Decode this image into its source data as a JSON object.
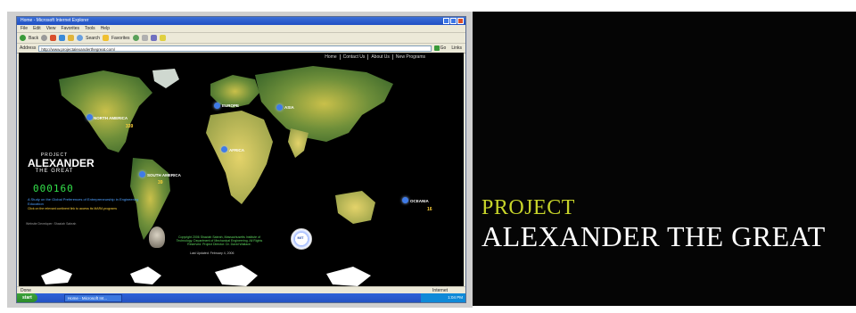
{
  "window": {
    "title": "Home - Microsoft Internet Explorer",
    "menu": [
      "File",
      "Edit",
      "View",
      "Favorites",
      "Tools",
      "Help"
    ],
    "toolbar": {
      "back": "Back",
      "search": "Search",
      "favorites": "Favorites"
    },
    "address_label": "Address",
    "address_value": "http://www.projectalexanderthegreat.com/",
    "go_label": "Go",
    "links_label": "Links",
    "status": "Done",
    "status_zone": "Internet"
  },
  "taskbar": {
    "start": "start",
    "task": "Home - Microsoft Int...",
    "time": "1:04 PM"
  },
  "site": {
    "nav": [
      "Home",
      "Contact Us",
      "About Us",
      "New Programs"
    ],
    "regions": [
      {
        "label": "NORTH AMERICA",
        "count": "339"
      },
      {
        "label": "EUROPE",
        "count": ""
      },
      {
        "label": "ASIA",
        "count": ""
      },
      {
        "label": "AFRICA",
        "count": ""
      },
      {
        "label": "SOUTH AMERICA",
        "count": "39"
      },
      {
        "label": "OCEANIA",
        "count": "16"
      }
    ],
    "logo": {
      "line1": "PROJECT",
      "line2": "ALEXANDER",
      "line3": "THE GREAT"
    },
    "counter": "000160",
    "subtitle": "A Study on the Global Preferences of Entrepreneurship in Engineering Education",
    "note": "Click on the relevant continent link to access its MARA programs",
    "note2": "Website Developer: Shaziah Sabrah",
    "credit": "Copyright 2006 Shaziah Sabrah, Massachusetts Institute of Technology. Department of Mechanical Engineering. All Rights Reserved. Project Director: Dr. David Wallace.",
    "credit2": "Last Updated: February 4, 2006",
    "seal": "MIT"
  },
  "headline": {
    "line1": "PROJECT",
    "line2": "ALEXANDER THE GREAT"
  },
  "colors": {
    "accent": "#c7d42a",
    "marker": "#3f7be8",
    "counter": "#33e04a"
  }
}
